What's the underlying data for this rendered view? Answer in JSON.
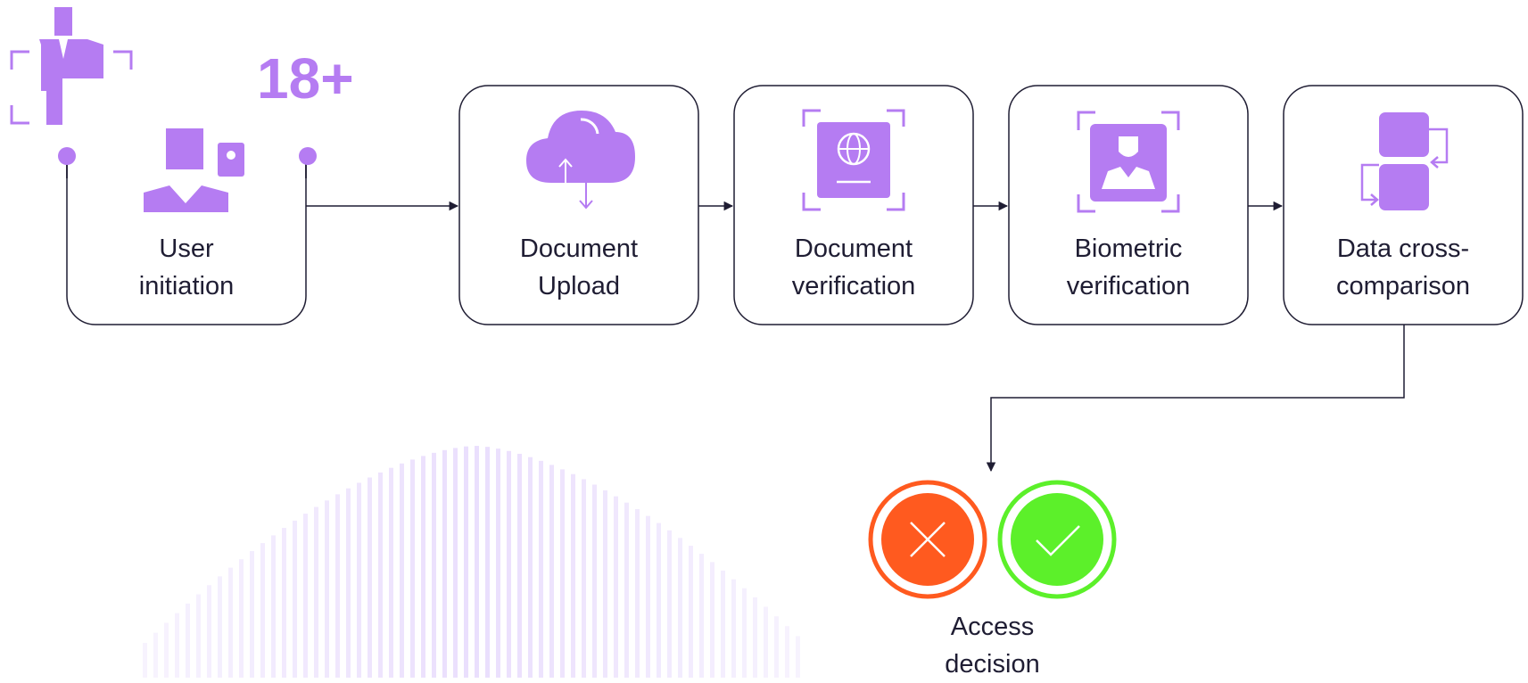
{
  "colors": {
    "accent": "#b57cf2",
    "stroke": "#1f1d33",
    "reject": "#ff5a1f",
    "approve": "#5cf02a",
    "stripes": "#d9c4fb"
  },
  "age_badge": "18+",
  "steps": [
    {
      "label": "User\ninitiation",
      "icon": "user-id-icon"
    },
    {
      "label": "Document\nUpload",
      "icon": "cloud-upload-icon"
    },
    {
      "label": "Document\nverification",
      "icon": "passport-scan-icon"
    },
    {
      "label": "Biometric\nverification",
      "icon": "face-scan-icon"
    },
    {
      "label": "Data cross-\ncomparison",
      "icon": "database-compare-icon"
    }
  ],
  "decision": {
    "label": "Access\ndecision",
    "reject_icon": "close-icon",
    "approve_icon": "check-icon"
  }
}
